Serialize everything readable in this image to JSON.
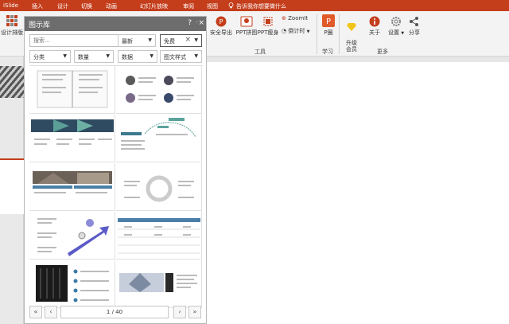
{
  "menubar": {
    "logo": "iSlide",
    "items": [
      "插入",
      "设计",
      "切换",
      "动画",
      "幻灯片放映",
      "审阅",
      "视图"
    ],
    "tell_me": "告诉我你想要做什么"
  },
  "ribbon": {
    "left_button": "设计排版",
    "tools": [
      {
        "label": "安全导出"
      },
      {
        "label": "PPT拼图"
      },
      {
        "label": "PPT瘦身"
      },
      {
        "label": "ZoomIt"
      },
      {
        "label": "倒计时"
      }
    ],
    "tools_group": "工具",
    "learn_button": "P圈",
    "learn_group": "学习",
    "more": [
      {
        "label": "升级\n会员"
      },
      {
        "label": "关于"
      },
      {
        "label": "设置"
      },
      {
        "label": "分享"
      }
    ],
    "more_group": "更多"
  },
  "panel": {
    "title": "图示库",
    "help": "?",
    "search_placeholder": "搜索...",
    "sort": "最新",
    "price": "免费",
    "filters": [
      "分类",
      "数量",
      "数据",
      "图文样式"
    ],
    "page_info": "1 / 40",
    "colors": {
      "accent": "#c43e1c",
      "title_bg": "#6d6d6d"
    }
  }
}
